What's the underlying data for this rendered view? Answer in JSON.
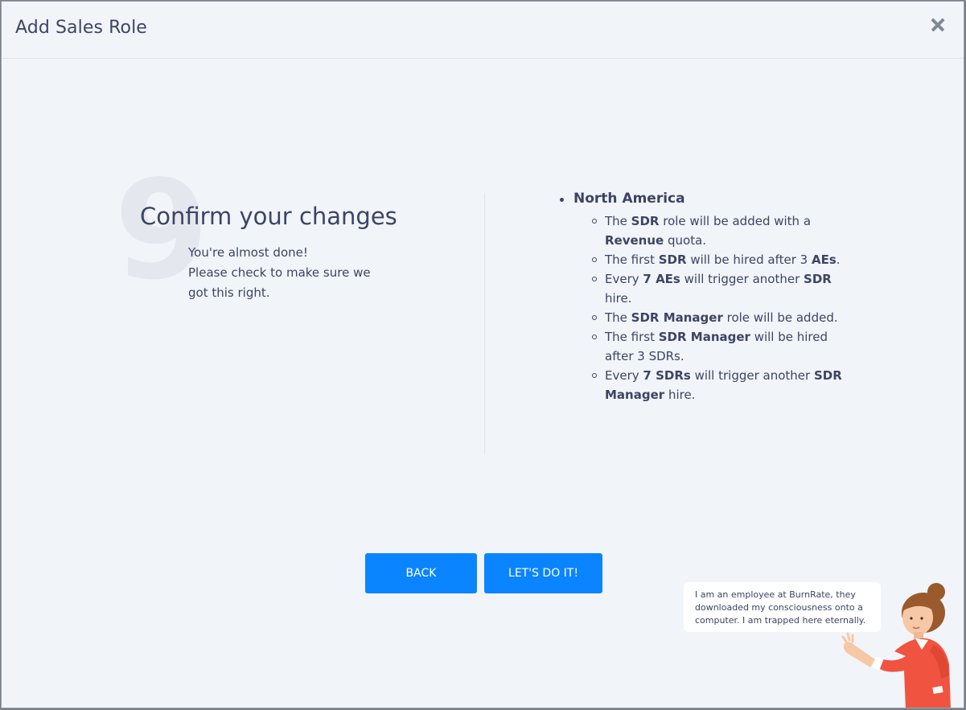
{
  "modal": {
    "title": "Add Sales Role"
  },
  "step": {
    "number": "9",
    "title": "Confirm your changes",
    "lines": [
      "You're almost done!",
      "Please check to make sure we",
      "got this right."
    ]
  },
  "summary": {
    "region": "North America",
    "items": [
      [
        {
          "t": "The "
        },
        {
          "t": "SDR",
          "b": true
        },
        {
          "t": " role will be added with a "
        },
        {
          "t": "Revenue",
          "b": true
        },
        {
          "t": " quota."
        }
      ],
      [
        {
          "t": "The first "
        },
        {
          "t": "SDR",
          "b": true
        },
        {
          "t": " will be hired after 3 "
        },
        {
          "t": "AEs",
          "b": true
        },
        {
          "t": "."
        }
      ],
      [
        {
          "t": "Every "
        },
        {
          "t": "7 AEs",
          "b": true
        },
        {
          "t": " will trigger another "
        },
        {
          "t": "SDR",
          "b": true
        },
        {
          "t": " hire."
        }
      ],
      [
        {
          "t": "The "
        },
        {
          "t": "SDR Manager",
          "b": true
        },
        {
          "t": " role will be added."
        }
      ],
      [
        {
          "t": "The first "
        },
        {
          "t": "SDR Manager",
          "b": true
        },
        {
          "t": " will be hired after 3 SDRs."
        }
      ],
      [
        {
          "t": "Every "
        },
        {
          "t": "7 SDRs",
          "b": true
        },
        {
          "t": " will trigger another "
        },
        {
          "t": "SDR Manager",
          "b": true
        },
        {
          "t": " hire."
        }
      ]
    ]
  },
  "buttons": {
    "back": "BACK",
    "confirm": "LET'S DO IT!"
  },
  "assistant": {
    "message": "I am an employee at BurnRate, they downloaded my consciousness onto a computer. I am trapped here eternally."
  },
  "colors": {
    "primary": "#0a84ff",
    "text": "#3d4463",
    "background": "#f1f5fa",
    "shirt": "#f0533f"
  },
  "icons": {
    "close": "close-icon"
  }
}
